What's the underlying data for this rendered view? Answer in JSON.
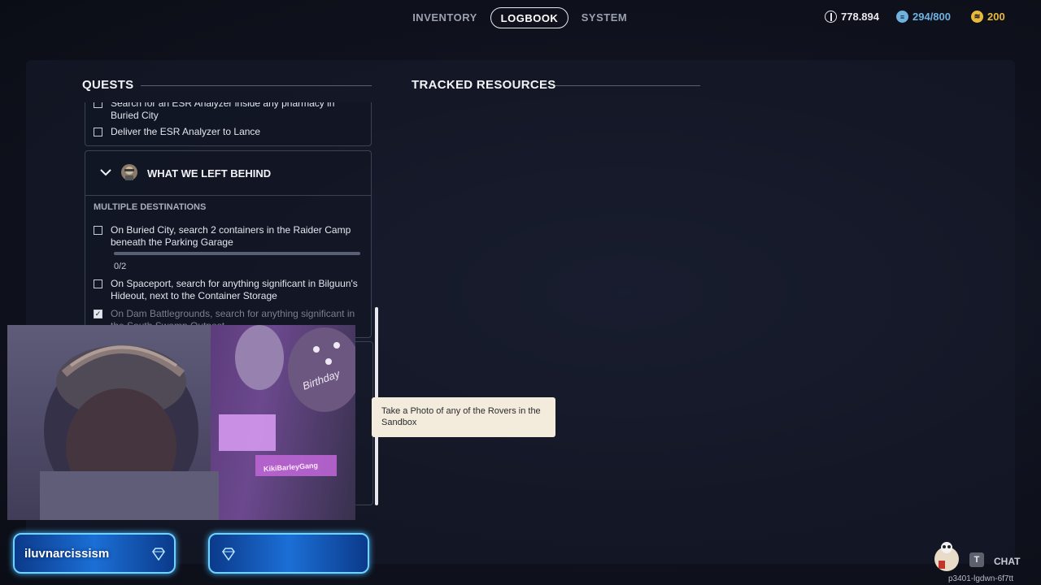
{
  "nav": {
    "tabs": [
      {
        "label": "INVENTORY"
      },
      {
        "label": "LOGBOOK",
        "active": true
      },
      {
        "label": "SYSTEM"
      }
    ]
  },
  "resources": {
    "coins": "778.894",
    "storage": "294/800",
    "tokens": "200"
  },
  "quests": {
    "title": "QUESTS",
    "prev_quest_tasks": [
      {
        "text": "Search for an ESR Analyzer inside any pharmacy in Buried City",
        "done": false
      },
      {
        "text": "Deliver the ESR Analyzer to Lance",
        "done": false
      }
    ],
    "current_quest": {
      "name": "WHAT WE LEFT BEHIND",
      "destination": "MULTIPLE DESTINATIONS",
      "tasks": [
        {
          "text": "On Buried City, search 2 containers in the Raider Camp beneath the Parking Garage",
          "done": false,
          "progress": "0/2",
          "progress_fraction": 0
        },
        {
          "text": "On Spaceport, search for anything significant in Bilguun's Hideout, next to the Container Storage",
          "done": false
        },
        {
          "text": "On Dam Battlegrounds, search for anything significant in the South Swamp Outpost",
          "done": true
        }
      ]
    }
  },
  "tracked": {
    "title": "TRACKED RESOURCES"
  },
  "tooltip": {
    "text": "Take a Photo of any of the Rovers in the Sandbox"
  },
  "webcam": {
    "sign_text": "KikiBarleyGang",
    "balloon_text": "Birthday"
  },
  "stream": {
    "username": "iluvnarcissism",
    "chat_key": "T",
    "chat_label": "CHAT",
    "session_id": "p3401-lgdwn-6f7tt"
  },
  "colors": {
    "accent": "#f2f3f7",
    "token_gold": "#e8b93a",
    "storage_blue": "#6fb2e0",
    "tooltip_bg": "#f3ecdc"
  }
}
